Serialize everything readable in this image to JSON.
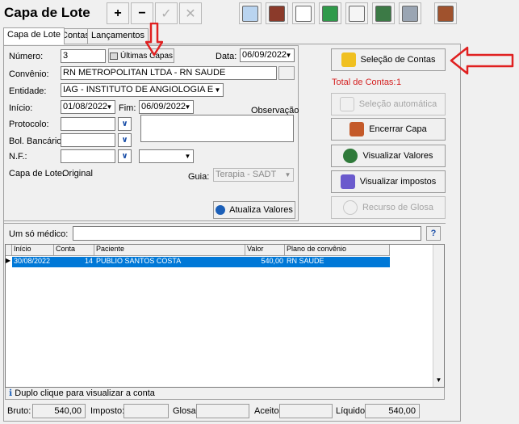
{
  "window": {
    "title": "Capa de Lote"
  },
  "toolbar": {
    "add": "+",
    "remove": "−",
    "check": "✓",
    "cancel": "✕"
  },
  "tabs": [
    {
      "label": "Capa de Lote"
    },
    {
      "label": "Contas"
    },
    {
      "label": "Lançamentos"
    }
  ],
  "form": {
    "numero_label": "Número:",
    "numero_value": "3",
    "ultimas_capas": "Últimas Capas",
    "data_label": "Data:",
    "data_value": "06/09/2022",
    "convenio_label": "Convênio:",
    "convenio_value": "RN METROPOLITAN LTDA - RN SAUDE",
    "entidade_label": "Entidade:",
    "entidade_value": "IAG - INSTITUTO DE ANGIOLOGIA E GASTI",
    "inicio_label": "Início:",
    "inicio_value": "01/08/2022",
    "fim_label": "Fim:",
    "fim_value": "06/09/2022",
    "observacao_label": "Observação",
    "protocolo_label": "Protocolo:",
    "bol_bancario_label": "Bol. Bancário:",
    "nf_label": "N.F.:",
    "capa_lote_label": "Capa de Lote:",
    "capa_lote_value": "Original",
    "guia_label": "Guia:",
    "guia_value": "Terapia - SADT",
    "atualiza_valores": "Atualiza Valores"
  },
  "side": {
    "selecao_contas": "Seleção de Contas",
    "total_label": "Total de Contas:",
    "total_value": "1",
    "selecao_automatica": "Seleção automática",
    "encerrar_capa": "Encerrar Capa",
    "visualizar_valores": "Visualizar Valores",
    "visualizar_impostos": "Visualizar impostos",
    "recurso_glosa": "Recurso de Glosa"
  },
  "medico": {
    "label": "Um só médico:",
    "help": "?"
  },
  "grid": {
    "columns": [
      "Início",
      "Conta",
      "Paciente",
      "Valor",
      "Plano de convênio"
    ],
    "rows": [
      {
        "inicio": "30/08/2022",
        "conta": "14",
        "paciente": "PUBLIO SANTOS COSTA",
        "valor": "540,00",
        "plano": "RN SAUDE"
      }
    ]
  },
  "status": {
    "hint": "Duplo clique para visualizar a conta"
  },
  "totals": {
    "bruto_label": "Bruto:",
    "bruto_value": "540,00",
    "imposto_label": "Imposto:",
    "imposto_value": "",
    "glosa_label": "Glosa:",
    "glosa_value": "",
    "aceito_label": "Aceito:",
    "aceito_value": "",
    "liquido_label": "Líquido:",
    "liquido_value": "540,00"
  },
  "colors": {
    "accent_red": "#e02020",
    "total_red": "#d42020",
    "row_select": "#0078d7"
  }
}
